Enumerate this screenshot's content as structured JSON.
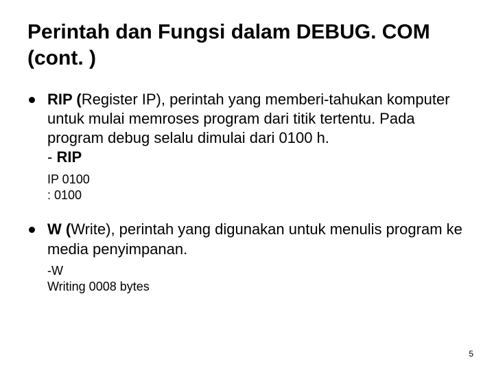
{
  "title": "Perintah dan Fungsi dalam DEBUG. COM  (cont. )",
  "item1": {
    "bold1": "RIP (",
    "rest1": "Register IP), perintah yang memberi-tahukan komputer untuk mulai memroses program dari titik tertentu.  Pada program debug selalu dimulai dari 0100 h.",
    "dash": "- ",
    "bold2": "RIP",
    "sub1": "IP 0100",
    "sub2": ": 0100"
  },
  "item2": {
    "bold1": "W (",
    "rest1": "Write), perintah yang digunakan untuk menulis program ke media penyimpanan.",
    "sub1": "-W",
    "sub2": "Writing 0008 bytes"
  },
  "page": "5"
}
